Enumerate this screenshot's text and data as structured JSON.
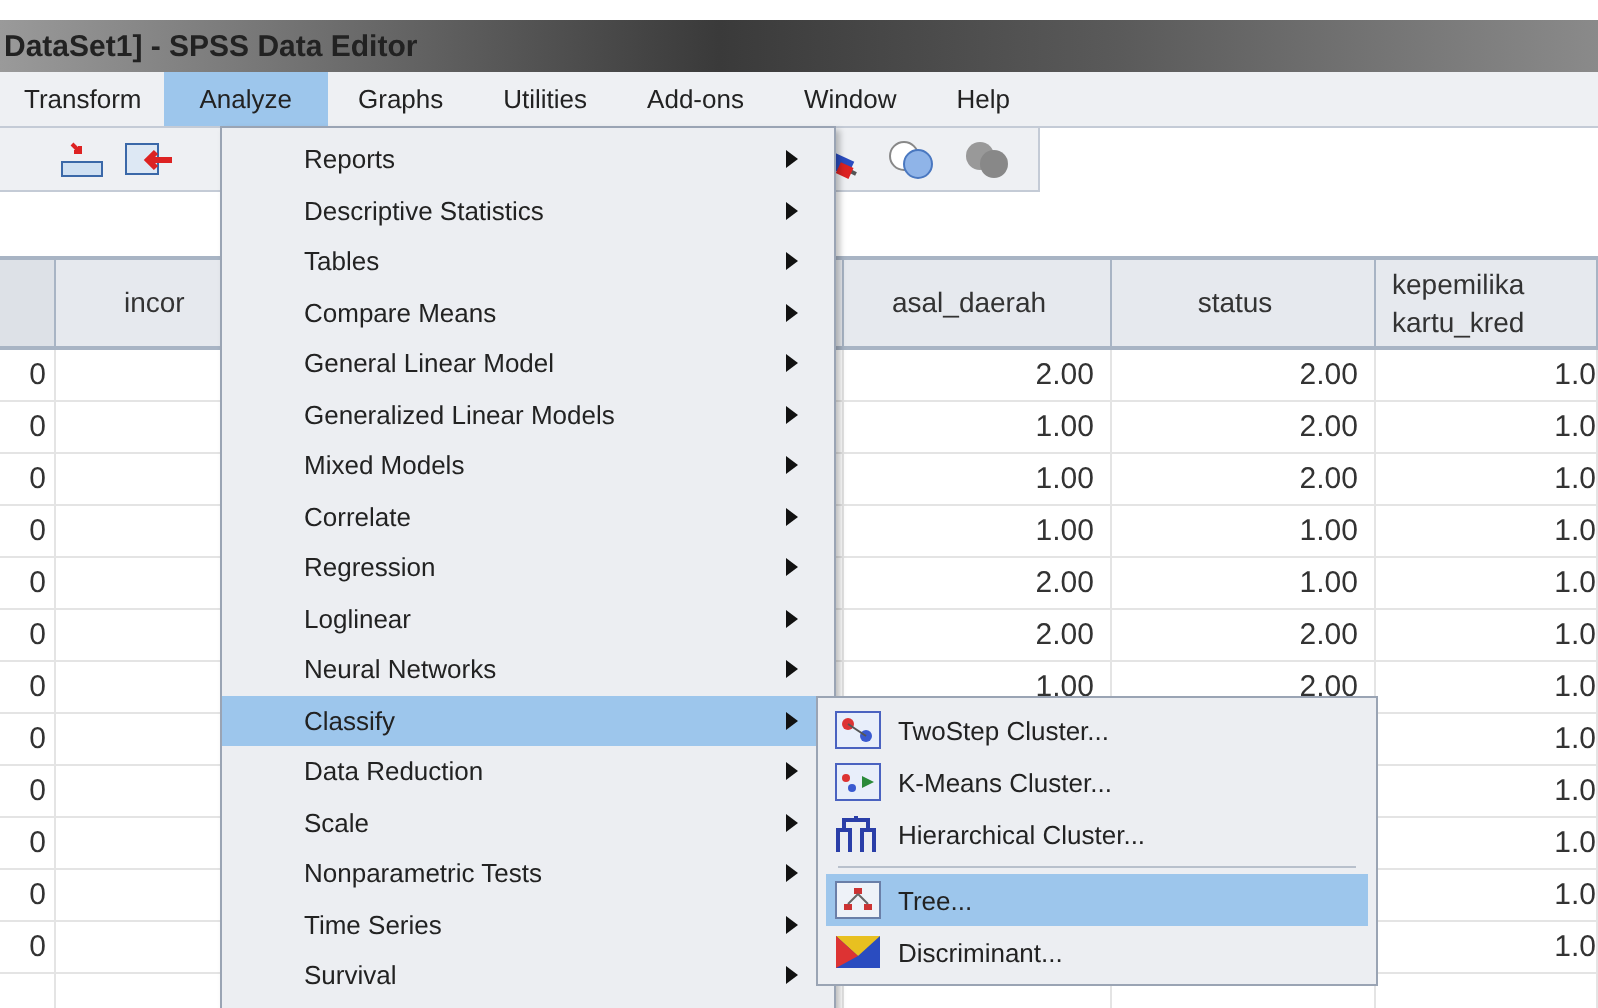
{
  "window": {
    "title": "DataSet1] - SPSS Data Editor"
  },
  "menu_bar": [
    {
      "label": "Transform",
      "selected": false
    },
    {
      "label": "Analyze",
      "selected": true
    },
    {
      "label": "Graphs",
      "selected": false
    },
    {
      "label": "Utilities",
      "selected": false
    },
    {
      "label": "Add-ons",
      "selected": false
    },
    {
      "label": "Window",
      "selected": false
    },
    {
      "label": "Help",
      "selected": false
    }
  ],
  "table": {
    "columns": [
      {
        "label": "incor"
      },
      {
        "label": "asal_daerah"
      },
      {
        "label": "status"
      },
      {
        "label": "kepemilika\nkartu_kred"
      }
    ],
    "rows": [
      {
        "column_1": "0",
        "asal_daerah": "2.00",
        "status": "2.00",
        "kepemilikan": "1.0"
      },
      {
        "column_1": "0",
        "asal_daerah": "1.00",
        "status": "2.00",
        "kepemilikan": "1.0"
      },
      {
        "column_1": "0",
        "asal_daerah": "1.00",
        "status": "2.00",
        "kepemilikan": "1.0"
      },
      {
        "column_1": "0",
        "asal_daerah": "1.00",
        "status": "1.00",
        "kepemilikan": "1.0"
      },
      {
        "column_1": "0",
        "asal_daerah": "2.00",
        "status": "1.00",
        "kepemilikan": "1.0"
      },
      {
        "column_1": "0",
        "asal_daerah": "2.00",
        "status": "2.00",
        "kepemilikan": "1.0"
      },
      {
        "column_1": "0",
        "asal_daerah": "1.00",
        "status": "2.00",
        "kepemilikan": "1.0"
      },
      {
        "column_1": "0",
        "kepemilikan": "1.0"
      },
      {
        "column_1": "0",
        "kepemilikan": "1.0"
      },
      {
        "column_1": "0",
        "kepemilikan": "1.0"
      },
      {
        "column_1": "0",
        "kepemilikan": "1.0"
      },
      {
        "column_1": "0",
        "kepemilikan": "1.0"
      }
    ]
  },
  "analyze_menu": [
    {
      "label": "Reports",
      "selected": false
    },
    {
      "label": "Descriptive Statistics",
      "selected": false
    },
    {
      "label": "Tables",
      "selected": false
    },
    {
      "label": "Compare Means",
      "selected": false
    },
    {
      "label": "General Linear Model",
      "selected": false
    },
    {
      "label": "Generalized Linear Models",
      "selected": false
    },
    {
      "label": "Mixed Models",
      "selected": false
    },
    {
      "label": "Correlate",
      "selected": false
    },
    {
      "label": "Regression",
      "selected": false
    },
    {
      "label": "Loglinear",
      "selected": false
    },
    {
      "label": "Neural Networks",
      "selected": false
    },
    {
      "label": "Classify",
      "selected": true
    },
    {
      "label": "Data Reduction",
      "selected": false
    },
    {
      "label": "Scale",
      "selected": false
    },
    {
      "label": "Nonparametric Tests",
      "selected": false
    },
    {
      "label": "Time Series",
      "selected": false
    },
    {
      "label": "Survival",
      "selected": false
    }
  ],
  "classify_submenu": [
    {
      "label": "TwoStep Cluster...",
      "kind": "twostep",
      "selected": false
    },
    {
      "label": "K-Means Cluster...",
      "kind": "kmeans",
      "selected": false
    },
    {
      "label": "Hierarchical Cluster...",
      "kind": "hierarchical",
      "selected": false
    },
    {
      "kind": "separator"
    },
    {
      "label": "Tree...",
      "kind": "tree",
      "selected": true
    },
    {
      "label": "Discriminant...",
      "kind": "discriminant",
      "selected": false
    }
  ]
}
